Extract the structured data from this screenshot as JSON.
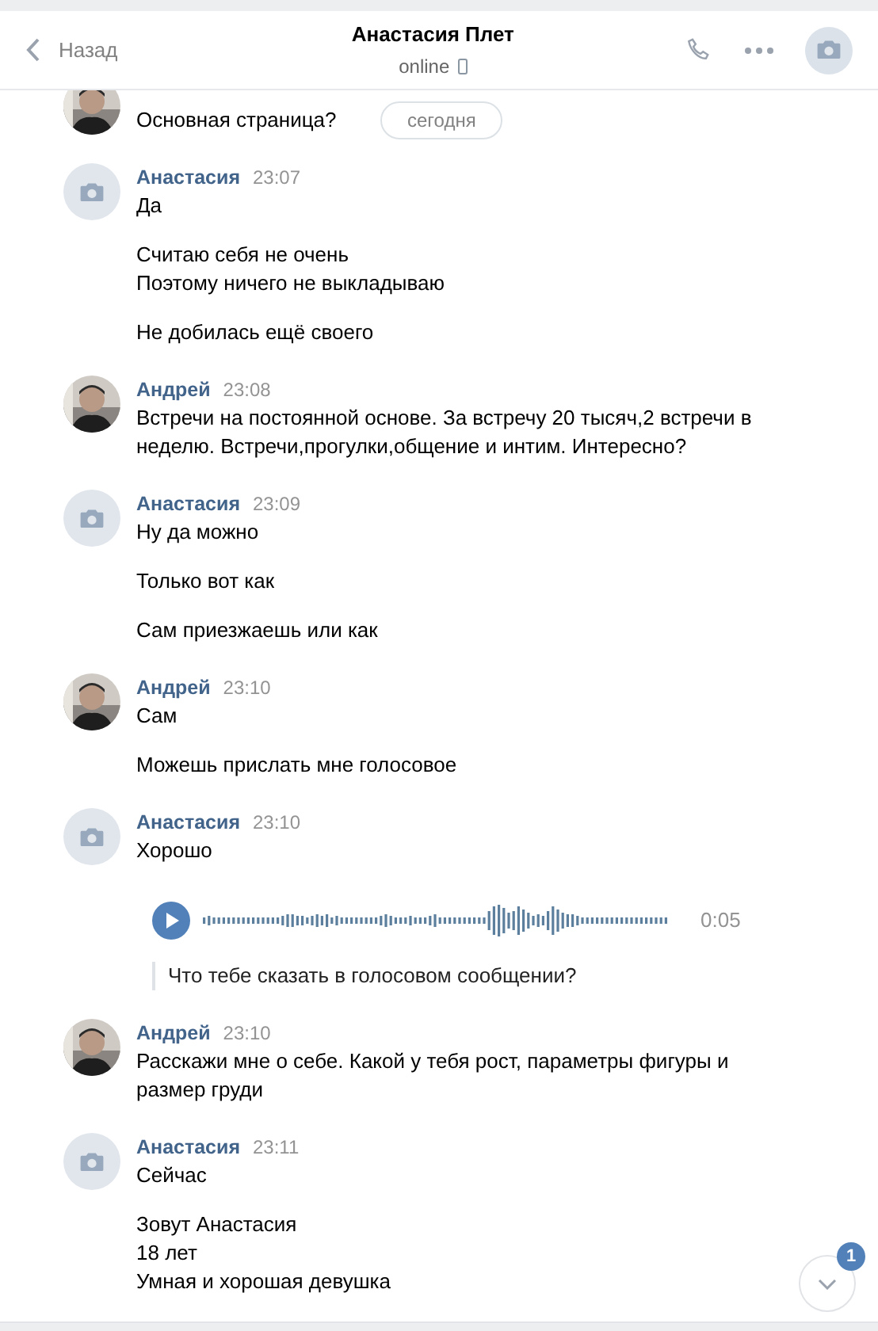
{
  "header": {
    "back": "Назад",
    "title": "Анастасия Плет",
    "status": "online"
  },
  "date_pill": "сегодня",
  "messages": [
    {
      "parts": [
        {
          "kind": "text",
          "text": "Основная страница?"
        }
      ]
    },
    {
      "author": "Анастасия",
      "time": "23:07",
      "kind": "camera",
      "parts": [
        {
          "kind": "text",
          "text": "Да"
        },
        {
          "kind": "text",
          "text": "Считаю себя не очень\nПоэтому ничего не выкладываю"
        },
        {
          "kind": "text",
          "text": "Не добилась ещё своего"
        }
      ]
    },
    {
      "author": "Андрей",
      "time": "23:08",
      "parts": [
        {
          "kind": "text",
          "text": "Встречи на постоянной основе. За встречу 20 тысяч,2 встречи в неделю. Встречи,прогулки,общение и интим. Интересно?"
        }
      ]
    },
    {
      "author": "Анастасия",
      "time": "23:09",
      "kind": "camera",
      "parts": [
        {
          "kind": "text",
          "text": "Ну да можно"
        },
        {
          "kind": "text",
          "text": "Только вот как"
        },
        {
          "kind": "text",
          "text": "Сам приезжаешь или как"
        }
      ]
    },
    {
      "author": "Андрей",
      "time": "23:10",
      "parts": [
        {
          "kind": "text",
          "text": "Сам"
        },
        {
          "kind": "text",
          "text": "Можешь прислать мне голосовое"
        }
      ]
    },
    {
      "author": "Анастасия",
      "time": "23:10",
      "kind": "camera",
      "parts": [
        {
          "kind": "text",
          "text": "Хорошо"
        },
        {
          "kind": "voice",
          "duration": "0:05",
          "transcript": "Что тебе сказать в голосовом сообщении?"
        }
      ]
    },
    {
      "author": "Андрей",
      "time": "23:10",
      "parts": [
        {
          "kind": "text",
          "text": "Расскажи мне о себе. Какой у тебя рост, параметры фигуры и размер груди"
        }
      ]
    },
    {
      "author": "Анастасия",
      "time": "23:11",
      "kind": "camera",
      "parts": [
        {
          "kind": "text",
          "text": "Сейчас"
        },
        {
          "kind": "text",
          "text": "Зовут Анастасия\n18 лет\nУмная и хорошая девушка"
        }
      ]
    }
  ],
  "scroll_down": {
    "badge": "1"
  }
}
